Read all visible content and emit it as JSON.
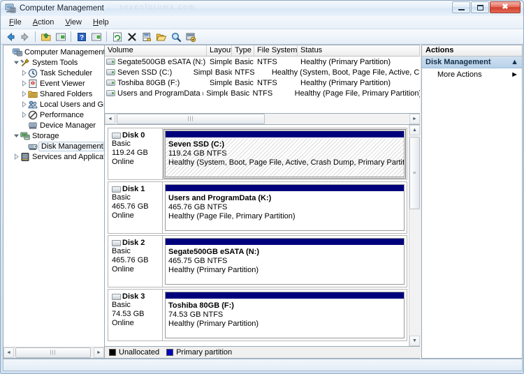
{
  "window": {
    "title": "Computer Management",
    "watermark": "sevenforums.com",
    "icon": "computer-management-icon",
    "controls": {
      "minimize": "Minimize",
      "maximize": "Maximize",
      "close": "Close"
    }
  },
  "menu": {
    "items": [
      {
        "label": "File",
        "accel": "F"
      },
      {
        "label": "Action",
        "accel": "A"
      },
      {
        "label": "View",
        "accel": "V"
      },
      {
        "label": "Help",
        "accel": "H"
      }
    ]
  },
  "toolbar": {
    "buttons": [
      {
        "name": "back-button",
        "icon": "left-arrow-icon"
      },
      {
        "name": "forward-button",
        "icon": "right-arrow-icon"
      },
      {
        "name": "up-one-level-button",
        "icon": "folder-up-icon"
      },
      {
        "name": "show-hide-tree-button",
        "icon": "tree-pane-icon"
      },
      {
        "name": "help-button",
        "icon": "question-mark-icon"
      },
      {
        "name": "show-hide-action-pane-button",
        "icon": "action-pane-icon"
      },
      {
        "name": "refresh-button",
        "icon": "refresh-icon"
      },
      {
        "name": "delete-button",
        "icon": "delete-x-icon"
      },
      {
        "name": "properties-button",
        "icon": "properties-icon"
      },
      {
        "name": "open-button",
        "icon": "open-folder-icon"
      },
      {
        "name": "rescan-disks-button",
        "icon": "magnifier-icon"
      },
      {
        "name": "create-vhd-button",
        "icon": "vhd-icon"
      }
    ]
  },
  "tree": {
    "nodes": [
      {
        "label": "Computer Management (Local",
        "indent": 0,
        "twist": "none",
        "icon": "computer-icon",
        "selected": false
      },
      {
        "label": "System Tools",
        "indent": 1,
        "twist": "expanded",
        "icon": "system-tools-icon",
        "selected": false
      },
      {
        "label": "Task Scheduler",
        "indent": 2,
        "twist": "collapsed",
        "icon": "clock-icon",
        "selected": false
      },
      {
        "label": "Event Viewer",
        "indent": 2,
        "twist": "collapsed",
        "icon": "event-viewer-icon",
        "selected": false
      },
      {
        "label": "Shared Folders",
        "indent": 2,
        "twist": "collapsed",
        "icon": "shared-folders-icon",
        "selected": false
      },
      {
        "label": "Local Users and Groups",
        "indent": 2,
        "twist": "collapsed",
        "icon": "users-icon",
        "selected": false
      },
      {
        "label": "Performance",
        "indent": 2,
        "twist": "collapsed",
        "icon": "performance-icon",
        "selected": false
      },
      {
        "label": "Device Manager",
        "indent": 2,
        "twist": "none",
        "icon": "device-manager-icon",
        "selected": false
      },
      {
        "label": "Storage",
        "indent": 1,
        "twist": "expanded",
        "icon": "storage-icon",
        "selected": false
      },
      {
        "label": "Disk Management",
        "indent": 2,
        "twist": "none",
        "icon": "disk-management-icon",
        "selected": true
      },
      {
        "label": "Services and Applications",
        "indent": 1,
        "twist": "collapsed",
        "icon": "services-icon",
        "selected": false
      }
    ],
    "hscroll": {
      "left_arrow": "◄",
      "right_arrow": "►",
      "grip": "|||"
    }
  },
  "volume_list": {
    "columns": [
      "Volume",
      "Layout",
      "Type",
      "File System",
      "Status"
    ],
    "rows": [
      {
        "volume": "Segate500GB eSATA (N:)",
        "layout": "Simple",
        "type": "Basic",
        "file_system": "NTFS",
        "status": "Healthy (Primary Partition)"
      },
      {
        "volume": "Seven SSD (C:)",
        "layout": "Simple",
        "type": "Basic",
        "file_system": "NTFS",
        "status": "Healthy (System, Boot, Page File, Active, Crash Du"
      },
      {
        "volume": "Toshiba 80GB (F:)",
        "layout": "Simple",
        "type": "Basic",
        "file_system": "NTFS",
        "status": "Healthy (Primary Partition)"
      },
      {
        "volume": "Users and ProgramData (K:)",
        "layout": "Simple",
        "type": "Basic",
        "file_system": "NTFS",
        "status": "Healthy (Page File, Primary Partition)"
      }
    ]
  },
  "mid_scroll": {
    "left_arrow": "◄",
    "right_arrow": "►",
    "grip": "|||"
  },
  "graphical_view": {
    "disks": [
      {
        "name": "Disk 0",
        "type": "Basic",
        "capacity": "119.24 GB",
        "state": "Online",
        "selected": true,
        "partition": {
          "name": "Seven SSD  (C:)",
          "size": "119.24 GB NTFS",
          "status": "Healthy (System, Boot, Page File, Active, Crash Dump, Primary Partition)"
        }
      },
      {
        "name": "Disk 1",
        "type": "Basic",
        "capacity": "465.76 GB",
        "state": "Online",
        "selected": false,
        "partition": {
          "name": "Users and ProgramData  (K:)",
          "size": "465.76 GB NTFS",
          "status": "Healthy (Page File, Primary Partition)"
        }
      },
      {
        "name": "Disk 2",
        "type": "Basic",
        "capacity": "465.76 GB",
        "state": "Online",
        "selected": false,
        "partition": {
          "name": "Segate500GB eSATA  (N:)",
          "size": "465.75 GB NTFS",
          "status": "Healthy (Primary Partition)"
        }
      },
      {
        "name": "Disk 3",
        "type": "Basic",
        "capacity": "74.53 GB",
        "state": "Online",
        "selected": false,
        "partition": {
          "name": "Toshiba 80GB  (F:)",
          "size": "74.53 GB NTFS",
          "status": "Healthy (Primary Partition)"
        }
      }
    ],
    "vscroll": {
      "up_arrow": "▲",
      "down_arrow": "▼",
      "grip": "≡"
    },
    "partition_color": "#00007C"
  },
  "legend": {
    "items": [
      {
        "label": "Unallocated",
        "color": "#000000"
      },
      {
        "label": "Primary partition",
        "color": "#0000BE"
      }
    ]
  },
  "actions": {
    "header": "Actions",
    "group": {
      "label": "Disk Management",
      "chevron": "▲"
    },
    "items": [
      {
        "label": "More Actions",
        "chevron": "►"
      }
    ]
  },
  "statusbar": {
    "text": ""
  }
}
